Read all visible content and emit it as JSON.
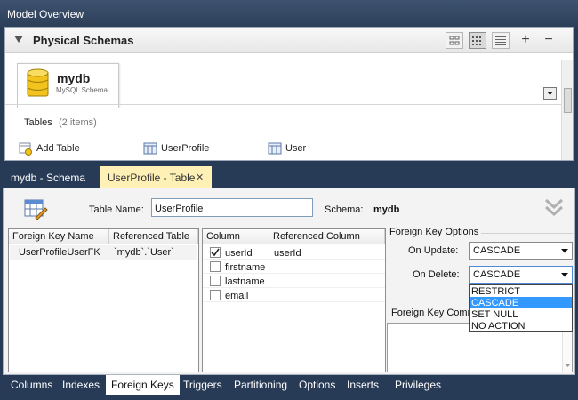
{
  "model_overview": {
    "title": "Model Overview",
    "section_title": "Physical Schemas",
    "toolbar": {
      "add": "+",
      "remove": "−"
    },
    "schema": {
      "name": "mydb",
      "type": "MySQL Schema"
    },
    "tables": {
      "label": "Tables",
      "count": "(2 items)",
      "items": [
        {
          "label": "Add Table",
          "icon": "add-table-icon"
        },
        {
          "label": "UserProfile",
          "icon": "table-icon"
        },
        {
          "label": "User",
          "icon": "table-icon"
        }
      ]
    }
  },
  "editor_tabs": [
    {
      "label": "mydb - Schema"
    },
    {
      "label": "UserProfile - Table",
      "close": "✕"
    }
  ],
  "editor": {
    "table_name_label": "Table Name:",
    "table_name_value": "UserProfile",
    "schema_label": "Schema:",
    "schema_value": "mydb",
    "fk_grid": {
      "headers": [
        "Foreign Key Name",
        "Referenced Table"
      ],
      "rows": [
        {
          "name": "UserProfileUserFK",
          "ref": "`mydb`.`User`"
        }
      ]
    },
    "column_grid": {
      "headers": [
        "Column",
        "Referenced Column"
      ],
      "rows": [
        {
          "column": "userId",
          "checked": true,
          "ref": "userId"
        },
        {
          "column": "firstname",
          "checked": false,
          "ref": ""
        },
        {
          "column": "lastname",
          "checked": false,
          "ref": ""
        },
        {
          "column": "email",
          "checked": false,
          "ref": ""
        }
      ]
    },
    "fk_options": {
      "title": "Foreign Key Options",
      "on_update_label": "On Update:",
      "on_update_value": "CASCADE",
      "on_delete_label": "On Delete:",
      "on_delete_value": "CASCADE",
      "on_delete_options": [
        "RESTRICT",
        "CASCADE",
        "SET NULL",
        "NO ACTION"
      ],
      "on_delete_highlighted": "CASCADE",
      "comment_label": "Foreign Key Comm"
    }
  },
  "bottom_tabs": [
    {
      "label": "Columns",
      "active": false
    },
    {
      "label": "Indexes",
      "active": false
    },
    {
      "label": "Foreign Keys",
      "active": true
    },
    {
      "label": "Triggers",
      "active": false
    },
    {
      "label": "Partitioning",
      "active": false
    },
    {
      "label": "Options",
      "active": false
    },
    {
      "label": "Inserts",
      "active": false
    },
    {
      "label": "Privileges",
      "active": false
    }
  ],
  "colors": {
    "background": "#283b56",
    "active_doc_tab": "#fff1b6",
    "selection": "#3399ff"
  }
}
